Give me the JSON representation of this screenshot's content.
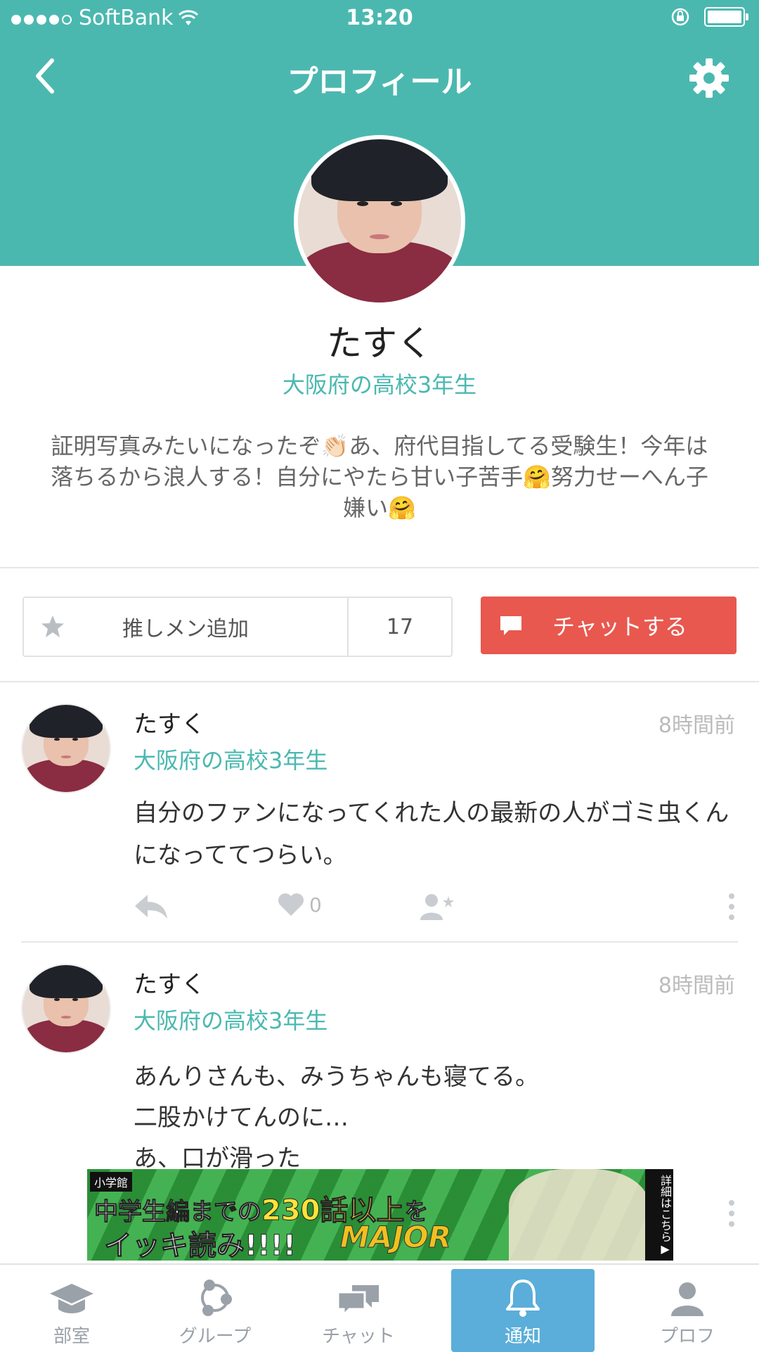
{
  "status_bar": {
    "carrier": "SoftBank",
    "time": "13:20"
  },
  "header": {
    "title": "プロフィール"
  },
  "profile": {
    "name": "たすく",
    "school": "大阪府の高校3年生",
    "bio": "証明写真みたいになったぞ👏🏻あ、府代目指してる受験生！今年は落ちるから浪人する！自分にやたら甘い子苦手🤗努力せーへん子嫌い🤗"
  },
  "actions": {
    "favorite_label": "推しメン追加",
    "favorite_count": "17",
    "chat_label": "チャットする"
  },
  "posts": [
    {
      "author": "たすく",
      "time": "8時間前",
      "school": "大阪府の高校3年生",
      "body": "自分のファンになってくれた人の最新の人がゴミ虫くんになっててつらい。",
      "likes": "0"
    },
    {
      "author": "たすく",
      "time": "8時間前",
      "school": "大阪府の高校3年生",
      "body": "あんりさんも、みうちゃんも寝てる。\n二股かけてんのに…\nあ、口が滑った"
    }
  ],
  "ad": {
    "publisher": "小学館",
    "line1_a": "中学生編までの",
    "line1_b": "230話以上",
    "line1_c": "を",
    "line2": "イッキ読み!!!!",
    "logo": "MAJOR",
    "info": "詳細はこちら▶"
  },
  "tabbar": {
    "items": [
      {
        "label": "部室"
      },
      {
        "label": "グループ"
      },
      {
        "label": "チャット"
      },
      {
        "label": "通知"
      },
      {
        "label": "プロフ"
      }
    ],
    "active_index": 3
  },
  "colors": {
    "brand": "#4bb8b0",
    "chat_button": "#e8584f",
    "tab_active": "#5aaed9"
  }
}
